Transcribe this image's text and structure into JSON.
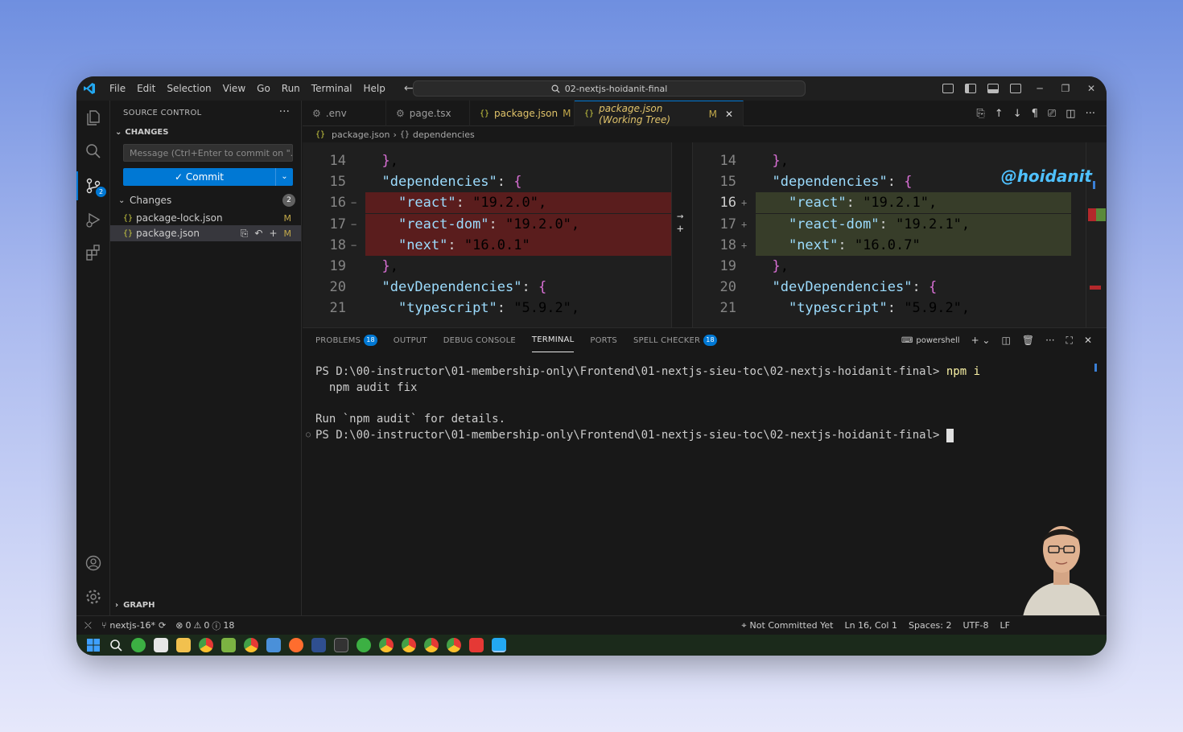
{
  "menu": [
    "File",
    "Edit",
    "Selection",
    "View",
    "Go",
    "Run",
    "Terminal",
    "Help"
  ],
  "search": {
    "value": "02-nextjs-hoidanit-final"
  },
  "sidebar": {
    "title": "SOURCE CONTROL",
    "section": "CHANGES",
    "commit_placeholder": "Message (Ctrl+Enter to commit on \"...",
    "commit_label": "Commit",
    "changes_label": "Changes",
    "changes_count": "2",
    "files": [
      {
        "name": "package-lock.json",
        "status": "M"
      },
      {
        "name": "package.json",
        "status": "M"
      }
    ],
    "graph_label": "GRAPH",
    "activity_badge": "2"
  },
  "tabs": [
    {
      "label": ".env"
    },
    {
      "label": "page.tsx"
    },
    {
      "label": "package.json",
      "status": "M"
    },
    {
      "label": "package.json (Working Tree)",
      "status": "M"
    }
  ],
  "breadcrumb": {
    "file": "package.json",
    "symbol": "dependencies"
  },
  "watermark": "@hoidanit",
  "diff": {
    "left": [
      {
        "ln": "14",
        "marker": "",
        "text": "  },",
        "type": "ctx"
      },
      {
        "ln": "15",
        "marker": "",
        "text": "  \"dependencies\": {",
        "type": "ctx"
      },
      {
        "ln": "16",
        "marker": "−",
        "text": "    \"react\": \"19.2.0\",",
        "type": "rm"
      },
      {
        "ln": "17",
        "marker": "−",
        "text": "    \"react-dom\": \"19.2.0\",",
        "type": "rm"
      },
      {
        "ln": "18",
        "marker": "−",
        "text": "    \"next\": \"16.0.1\"",
        "type": "rm"
      },
      {
        "ln": "19",
        "marker": "",
        "text": "  },",
        "type": "ctx"
      },
      {
        "ln": "20",
        "marker": "",
        "text": "  \"devDependencies\": {",
        "type": "ctx"
      },
      {
        "ln": "21",
        "marker": "",
        "text": "    \"typescript\": \"5.9.2\",",
        "type": "ctx"
      }
    ],
    "right": [
      {
        "ln": "14",
        "marker": "",
        "text": "  },",
        "type": "ctx"
      },
      {
        "ln": "15",
        "marker": "",
        "text": "  \"dependencies\": {",
        "type": "ctx"
      },
      {
        "ln": "16",
        "marker": "+",
        "text": "    \"react\": \"19.2.1\",",
        "type": "add"
      },
      {
        "ln": "17",
        "marker": "+",
        "text": "    \"react-dom\": \"19.2.1\",",
        "type": "add"
      },
      {
        "ln": "18",
        "marker": "+",
        "text": "    \"next\": \"16.0.7\"",
        "type": "add"
      },
      {
        "ln": "19",
        "marker": "",
        "text": "  },",
        "type": "ctx"
      },
      {
        "ln": "20",
        "marker": "",
        "text": "  \"devDependencies\": {",
        "type": "ctx"
      },
      {
        "ln": "21",
        "marker": "",
        "text": "    \"typescript\": \"5.9.2\",",
        "type": "ctx"
      }
    ]
  },
  "panel": {
    "tabs": [
      {
        "label": "PROBLEMS",
        "badge": "18"
      },
      {
        "label": "OUTPUT"
      },
      {
        "label": "DEBUG CONSOLE"
      },
      {
        "label": "TERMINAL"
      },
      {
        "label": "PORTS"
      },
      {
        "label": "SPELL CHECKER",
        "badge": "18"
      }
    ],
    "shell": "powershell",
    "terminal": {
      "prompt1": "PS D:\\00-instructor\\01-membership-only\\Frontend\\01-nextjs-sieu-toc\\02-nextjs-hoidanit-final> ",
      "cmd1": "npm i",
      "line2": "  npm audit fix",
      "line3": "Run `npm audit` for details.",
      "prompt2": "PS D:\\00-instructor\\01-membership-only\\Frontend\\01-nextjs-sieu-toc\\02-nextjs-hoidanit-final> "
    }
  },
  "status": {
    "branch": "nextjs-16*",
    "errors": "0",
    "warnings": "0",
    "infos": "18",
    "blame": "Not Committed Yet",
    "cursor": "Ln 16, Col 1",
    "spaces": "Spaces: 2",
    "encoding": "UTF-8",
    "eol": "LF"
  },
  "colors": {
    "accent": "#0078d4",
    "removed": "#5a1d1d",
    "added": "#373d29"
  }
}
